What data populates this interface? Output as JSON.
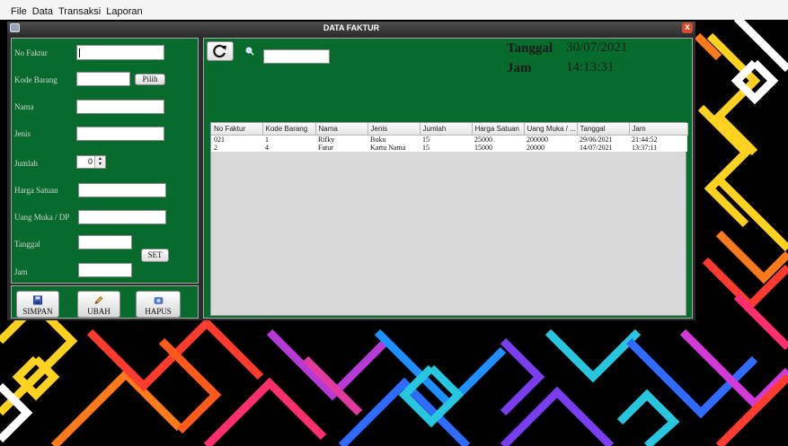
{
  "menu": [
    "File",
    "Data",
    "Transaksi",
    "Laporan"
  ],
  "window": {
    "title": "DATA FAKTUR",
    "close_glyph": "x"
  },
  "form": {
    "labels": {
      "no_faktur": "No Faktur",
      "kode_barang": "Kode Barang",
      "nama": "Nama",
      "jenis": "Jenis",
      "jumlah": "Jumlah",
      "harga_satuan": "Harga Satuan",
      "uang_muka": "Uang Muka / DP",
      "tanggal": "Tanggal",
      "jam": "Jam"
    },
    "values": {
      "no_faktur": "",
      "kode_barang": "",
      "nama": "",
      "jenis": "",
      "jumlah": "0",
      "harga_satuan": "",
      "uang_muka": "",
      "tanggal": "",
      "jam": ""
    },
    "pilih_button": "Pilih",
    "set_button": "SET"
  },
  "actions": {
    "simpan": "SIMPAN",
    "ubah": "UBAH",
    "hapus": "HAPUS"
  },
  "search": {
    "value": ""
  },
  "clock": {
    "tanggal_label": "Tanggal",
    "tanggal_value": "30/07/2021",
    "jam_label": "Jam",
    "jam_value": "14:13:31"
  },
  "table": {
    "columns": [
      "No Faktur",
      "Kode Barang",
      "Nama",
      "Jenis",
      "Jumlah",
      "Harga Satuan",
      "Uang Muka / ...",
      "Tanggal",
      "Jam"
    ],
    "rows": [
      [
        "021",
        "1",
        "Rifky",
        "Buku",
        "15",
        "25000",
        "200000",
        "29/06/2021",
        "21:44:52"
      ],
      [
        "2",
        "4",
        "Fatur",
        "Kartu Nama",
        "15",
        "15000",
        "20000",
        "14/07/2021",
        "13:37:11"
      ]
    ]
  },
  "colors": {
    "panel_green": "#066b2c",
    "frame_dark": "#2c2c2c",
    "close_red": "#d64b2d"
  },
  "icons": [
    "refresh-icon",
    "search-icon",
    "save-icon",
    "pencil-icon",
    "delete-icon",
    "spinner-arrows-icon",
    "window-menu-icon",
    "close-icon"
  ]
}
